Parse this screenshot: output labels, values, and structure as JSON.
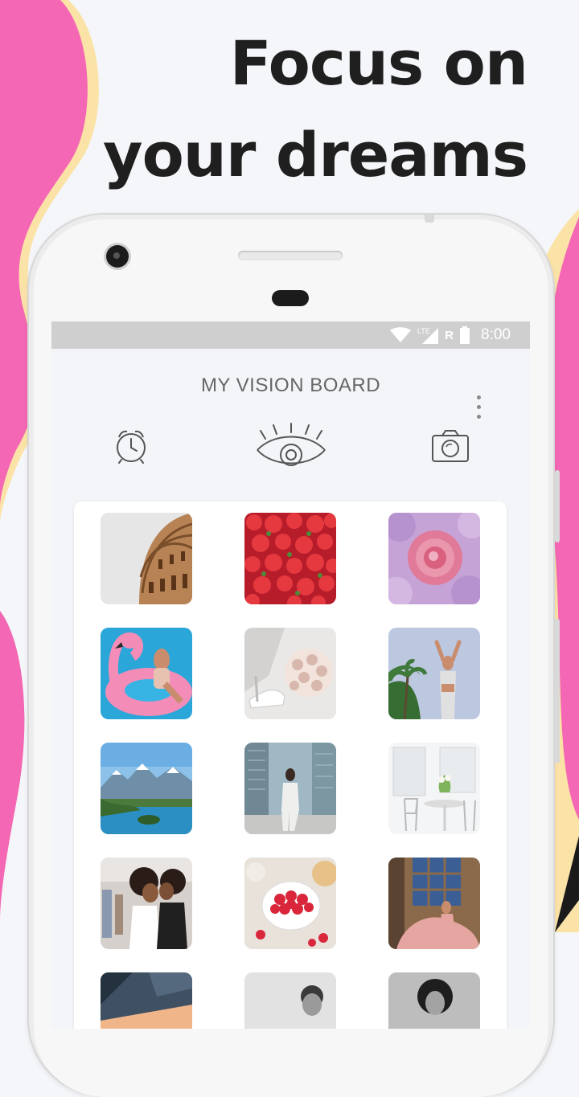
{
  "headline": {
    "line1": "Focus on",
    "line2": "your dreams"
  },
  "statusbar": {
    "network": "LTE",
    "roaming": "R",
    "time": "8:00"
  },
  "app": {
    "title": "MY VISION BOARD"
  },
  "toolbar": {
    "alarm_icon": "alarm-clock-icon",
    "focus_icon": "eye-icon",
    "camera_icon": "camera-icon"
  },
  "colors": {
    "pink": "#f467b4",
    "yellow": "#fbe3a8",
    "background": "#f4f6f9",
    "text_dark": "#1f1f1f"
  },
  "board": {
    "images": [
      "colosseum",
      "strawberries",
      "pink-rose",
      "pink-flamingo-float",
      "wedding-shoes-bouquet",
      "woman-palm-trees",
      "mountain-lake",
      "woman-city-street",
      "white-dining-room",
      "mother-daughter",
      "raspberries-bowl",
      "woman-pink-gown",
      "skyscrapers-sunset",
      "smiling-man",
      "woman-portrait"
    ]
  }
}
